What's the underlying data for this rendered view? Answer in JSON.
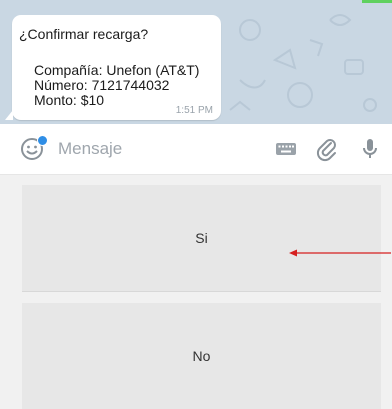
{
  "message": {
    "title": "¿Confirmar recarga?",
    "company": "Compañía: Unefon (AT&T)",
    "number": "Número: 7121744032",
    "amount": "Monto: $10",
    "time": "1:51 PM"
  },
  "input_bar": {
    "placeholder": "Mensaje",
    "icons": [
      "emoji-icon",
      "keyboard-icon",
      "attach-icon",
      "microphone-icon"
    ]
  },
  "keyboard": {
    "buttons": [
      {
        "label": "Si"
      },
      {
        "label": "No"
      }
    ]
  },
  "colors": {
    "chat_background": "#c9d7e3",
    "keyboard_background": "#f1f1f1",
    "button": "#e7e7e7",
    "arrow": "#d62020",
    "emoji_badge": "#2f8ee6"
  }
}
